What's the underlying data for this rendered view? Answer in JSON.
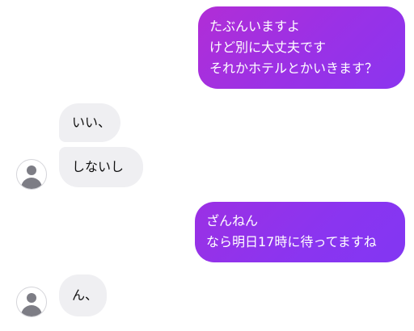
{
  "conversation": {
    "outgoing_1": {
      "lines": [
        "たぶんいますよ",
        "けど別に大丈夫です",
        "それかホテルとかいきます？"
      ]
    },
    "incoming_1": {
      "text": "いい、"
    },
    "incoming_2": {
      "text": "しないし"
    },
    "outgoing_2": {
      "lines": [
        "ざんねん",
        "なら明日17時に待ってますね"
      ]
    },
    "incoming_3": {
      "text": "ん、"
    }
  },
  "avatar_icon": "default-user-icon",
  "colors": {
    "outgoing_bubble_gradient": [
      "#b12ed6",
      "#8b35ef"
    ],
    "incoming_bubble": "#efeff2",
    "avatar_gray": "#7d7d85"
  }
}
